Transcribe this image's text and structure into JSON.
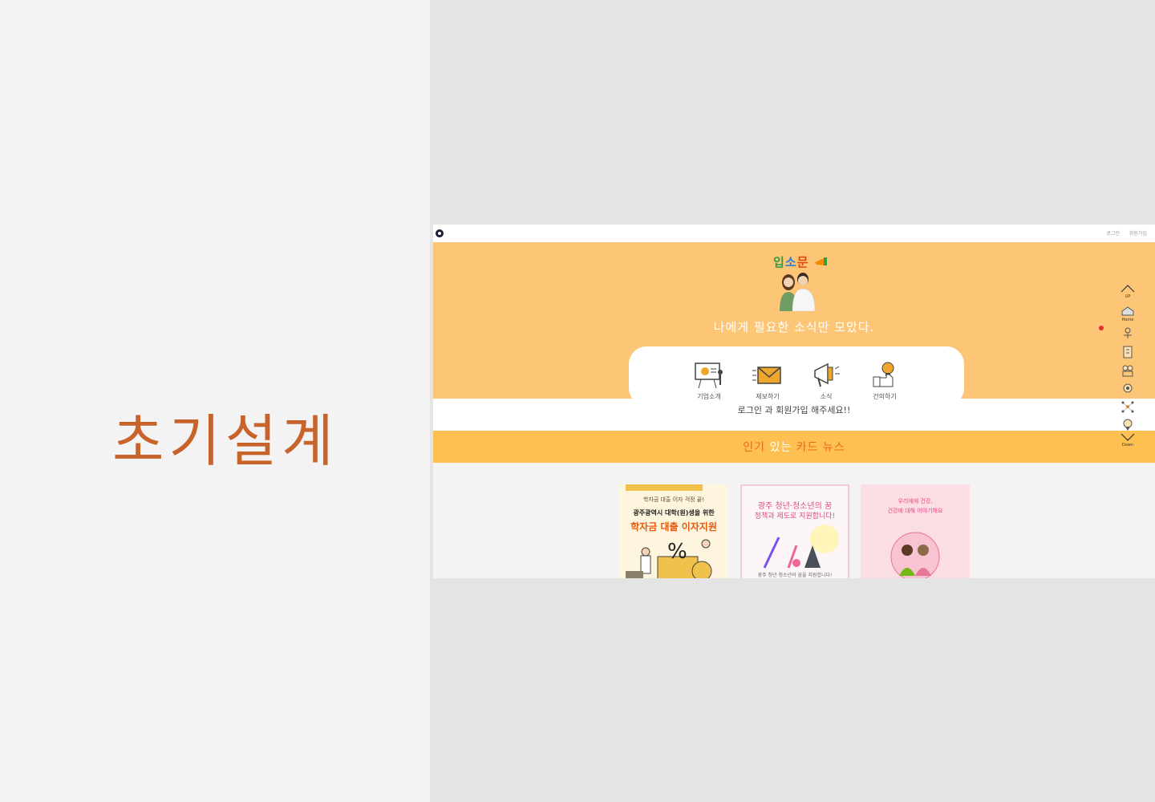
{
  "slide": {
    "title": "초기설계"
  },
  "header": {
    "links": [
      "로그인",
      "회원가입"
    ]
  },
  "hero": {
    "brand": [
      "입",
      "소",
      "문"
    ],
    "tagline": "나에게 필요한 소식만 모았다.",
    "menu": [
      {
        "label": "기업소개",
        "icon": "presentation-board-icon"
      },
      {
        "label": "제보하기",
        "icon": "envelope-icon"
      },
      {
        "label": "소식",
        "icon": "megaphone-icon"
      },
      {
        "label": "건의하기",
        "icon": "lightbulb-thumbs-up-icon"
      }
    ]
  },
  "login_message": "로그인 과 회원가입 해주세요!!",
  "news_banner": {
    "title_parts": [
      "인기",
      " 있는 ",
      "카드 뉴스"
    ]
  },
  "cards": [
    {
      "kicker": "광주광역시 대학(원)생을 위한",
      "headline": "학자금 대출 이자지원",
      "script": "학자금 대출 이자 걱정 끝!"
    },
    {
      "headline": "광주 청년·청소년의 꿈",
      "sub": "정책과 제도로 지원합니다!",
      "footer": "광주 청년 청소년의 꿈을 지원합니다!"
    },
    {
      "headline": "우리에에 건강,",
      "sub": "건강에 대해 이야기해요"
    }
  ],
  "side_nav": [
    "UP",
    "Home",
    "Down"
  ],
  "colors": {
    "accent": "#c8632c",
    "hero": "#fdc676",
    "banner": "#fec050"
  }
}
